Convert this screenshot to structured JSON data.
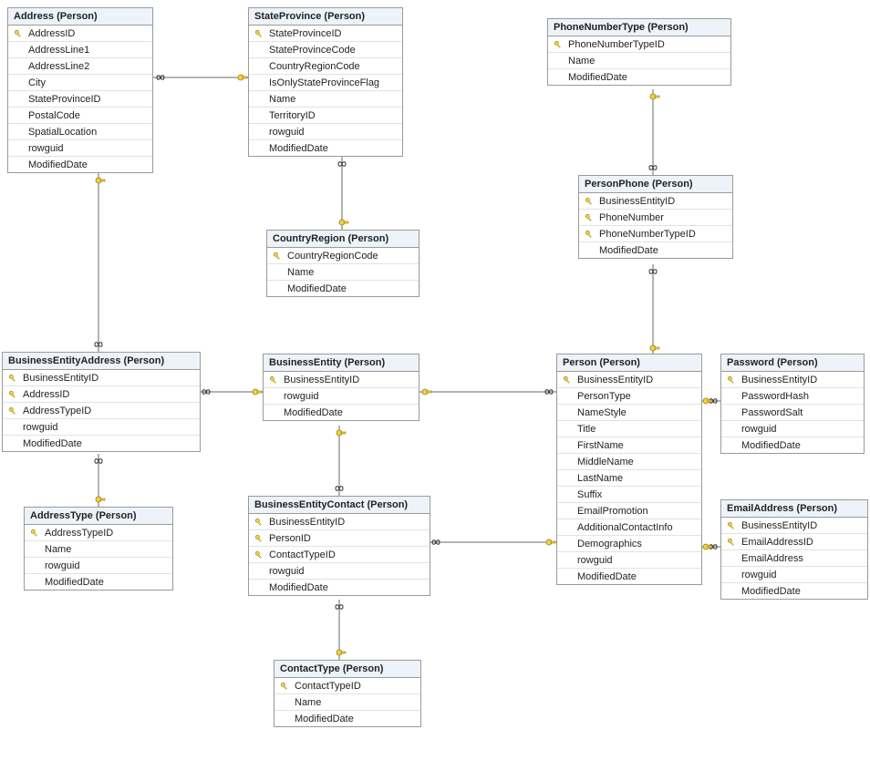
{
  "entities": {
    "address": {
      "title": "Address (Person)",
      "columns": [
        {
          "name": "AddressID",
          "pk": true
        },
        {
          "name": "AddressLine1",
          "pk": false
        },
        {
          "name": "AddressLine2",
          "pk": false
        },
        {
          "name": "City",
          "pk": false
        },
        {
          "name": "StateProvinceID",
          "pk": false
        },
        {
          "name": "PostalCode",
          "pk": false
        },
        {
          "name": "SpatialLocation",
          "pk": false
        },
        {
          "name": "rowguid",
          "pk": false
        },
        {
          "name": "ModifiedDate",
          "pk": false
        }
      ]
    },
    "stateProvince": {
      "title": "StateProvince (Person)",
      "columns": [
        {
          "name": "StateProvinceID",
          "pk": true
        },
        {
          "name": "StateProvinceCode",
          "pk": false
        },
        {
          "name": "CountryRegionCode",
          "pk": false
        },
        {
          "name": "IsOnlyStateProvinceFlag",
          "pk": false
        },
        {
          "name": "Name",
          "pk": false
        },
        {
          "name": "TerritoryID",
          "pk": false
        },
        {
          "name": "rowguid",
          "pk": false
        },
        {
          "name": "ModifiedDate",
          "pk": false
        }
      ]
    },
    "phoneNumberType": {
      "title": "PhoneNumberType (Person)",
      "columns": [
        {
          "name": "PhoneNumberTypeID",
          "pk": true
        },
        {
          "name": "Name",
          "pk": false
        },
        {
          "name": "ModifiedDate",
          "pk": false
        }
      ]
    },
    "countryRegion": {
      "title": "CountryRegion (Person)",
      "columns": [
        {
          "name": "CountryRegionCode",
          "pk": true
        },
        {
          "name": "Name",
          "pk": false
        },
        {
          "name": "ModifiedDate",
          "pk": false
        }
      ]
    },
    "personPhone": {
      "title": "PersonPhone (Person)",
      "columns": [
        {
          "name": "BusinessEntityID",
          "pk": true
        },
        {
          "name": "PhoneNumber",
          "pk": true
        },
        {
          "name": "PhoneNumberTypeID",
          "pk": true
        },
        {
          "name": "ModifiedDate",
          "pk": false
        }
      ]
    },
    "businessEntityAddress": {
      "title": "BusinessEntityAddress (Person)",
      "columns": [
        {
          "name": "BusinessEntityID",
          "pk": true
        },
        {
          "name": "AddressID",
          "pk": true
        },
        {
          "name": "AddressTypeID",
          "pk": true
        },
        {
          "name": "rowguid",
          "pk": false
        },
        {
          "name": "ModifiedDate",
          "pk": false
        }
      ]
    },
    "businessEntity": {
      "title": "BusinessEntity (Person)",
      "columns": [
        {
          "name": "BusinessEntityID",
          "pk": true
        },
        {
          "name": "rowguid",
          "pk": false
        },
        {
          "name": "ModifiedDate",
          "pk": false
        }
      ]
    },
    "person": {
      "title": "Person (Person)",
      "columns": [
        {
          "name": "BusinessEntityID",
          "pk": true
        },
        {
          "name": "PersonType",
          "pk": false
        },
        {
          "name": "NameStyle",
          "pk": false
        },
        {
          "name": "Title",
          "pk": false
        },
        {
          "name": "FirstName",
          "pk": false
        },
        {
          "name": "MiddleName",
          "pk": false
        },
        {
          "name": "LastName",
          "pk": false
        },
        {
          "name": "Suffix",
          "pk": false
        },
        {
          "name": "EmailPromotion",
          "pk": false
        },
        {
          "name": "AdditionalContactInfo",
          "pk": false
        },
        {
          "name": "Demographics",
          "pk": false
        },
        {
          "name": "rowguid",
          "pk": false
        },
        {
          "name": "ModifiedDate",
          "pk": false
        }
      ]
    },
    "password": {
      "title": "Password (Person)",
      "columns": [
        {
          "name": "BusinessEntityID",
          "pk": true
        },
        {
          "name": "PasswordHash",
          "pk": false
        },
        {
          "name": "PasswordSalt",
          "pk": false
        },
        {
          "name": "rowguid",
          "pk": false
        },
        {
          "name": "ModifiedDate",
          "pk": false
        }
      ]
    },
    "businessEntityContact": {
      "title": "BusinessEntityContact (Person)",
      "columns": [
        {
          "name": "BusinessEntityID",
          "pk": true
        },
        {
          "name": "PersonID",
          "pk": true
        },
        {
          "name": "ContactTypeID",
          "pk": true
        },
        {
          "name": "rowguid",
          "pk": false
        },
        {
          "name": "ModifiedDate",
          "pk": false
        }
      ]
    },
    "emailAddress": {
      "title": "EmailAddress (Person)",
      "columns": [
        {
          "name": "BusinessEntityID",
          "pk": true
        },
        {
          "name": "EmailAddressID",
          "pk": true
        },
        {
          "name": "EmailAddress",
          "pk": false
        },
        {
          "name": "rowguid",
          "pk": false
        },
        {
          "name": "ModifiedDate",
          "pk": false
        }
      ]
    },
    "addressType": {
      "title": "AddressType (Person)",
      "columns": [
        {
          "name": "AddressTypeID",
          "pk": true
        },
        {
          "name": "Name",
          "pk": false
        },
        {
          "name": "rowguid",
          "pk": false
        },
        {
          "name": "ModifiedDate",
          "pk": false
        }
      ]
    },
    "contactType": {
      "title": "ContactType (Person)",
      "columns": [
        {
          "name": "ContactTypeID",
          "pk": true
        },
        {
          "name": "Name",
          "pk": false
        },
        {
          "name": "ModifiedDate",
          "pk": false
        }
      ]
    }
  },
  "relationships": [
    {
      "from": "address",
      "to": "stateProvince",
      "label": "Address.StateProvinceID -> StateProvince.StateProvinceID"
    },
    {
      "from": "stateProvince",
      "to": "countryRegion",
      "label": "StateProvince.CountryRegionCode -> CountryRegion.CountryRegionCode"
    },
    {
      "from": "businessEntityAddress",
      "to": "address",
      "label": "BusinessEntityAddress.AddressID -> Address.AddressID"
    },
    {
      "from": "businessEntityAddress",
      "to": "businessEntity",
      "label": "BusinessEntityAddress.BusinessEntityID -> BusinessEntity.BusinessEntityID"
    },
    {
      "from": "businessEntityAddress",
      "to": "addressType",
      "label": "BusinessEntityAddress.AddressTypeID -> AddressType.AddressTypeID"
    },
    {
      "from": "businessEntityContact",
      "to": "businessEntity",
      "label": "BusinessEntityContact.BusinessEntityID -> BusinessEntity.BusinessEntityID"
    },
    {
      "from": "businessEntityContact",
      "to": "person",
      "label": "BusinessEntityContact.PersonID -> Person.BusinessEntityID"
    },
    {
      "from": "businessEntityContact",
      "to": "contactType",
      "label": "BusinessEntityContact.ContactTypeID -> ContactType.ContactTypeID"
    },
    {
      "from": "person",
      "to": "businessEntity",
      "label": "Person.BusinessEntityID -> BusinessEntity.BusinessEntityID"
    },
    {
      "from": "personPhone",
      "to": "person",
      "label": "PersonPhone.BusinessEntityID -> Person.BusinessEntityID"
    },
    {
      "from": "personPhone",
      "to": "phoneNumberType",
      "label": "PersonPhone.PhoneNumberTypeID -> PhoneNumberType.PhoneNumberTypeID"
    },
    {
      "from": "password",
      "to": "person",
      "label": "Password.BusinessEntityID -> Person.BusinessEntityID"
    },
    {
      "from": "emailAddress",
      "to": "person",
      "label": "EmailAddress.BusinessEntityID -> Person.BusinessEntityID"
    }
  ]
}
